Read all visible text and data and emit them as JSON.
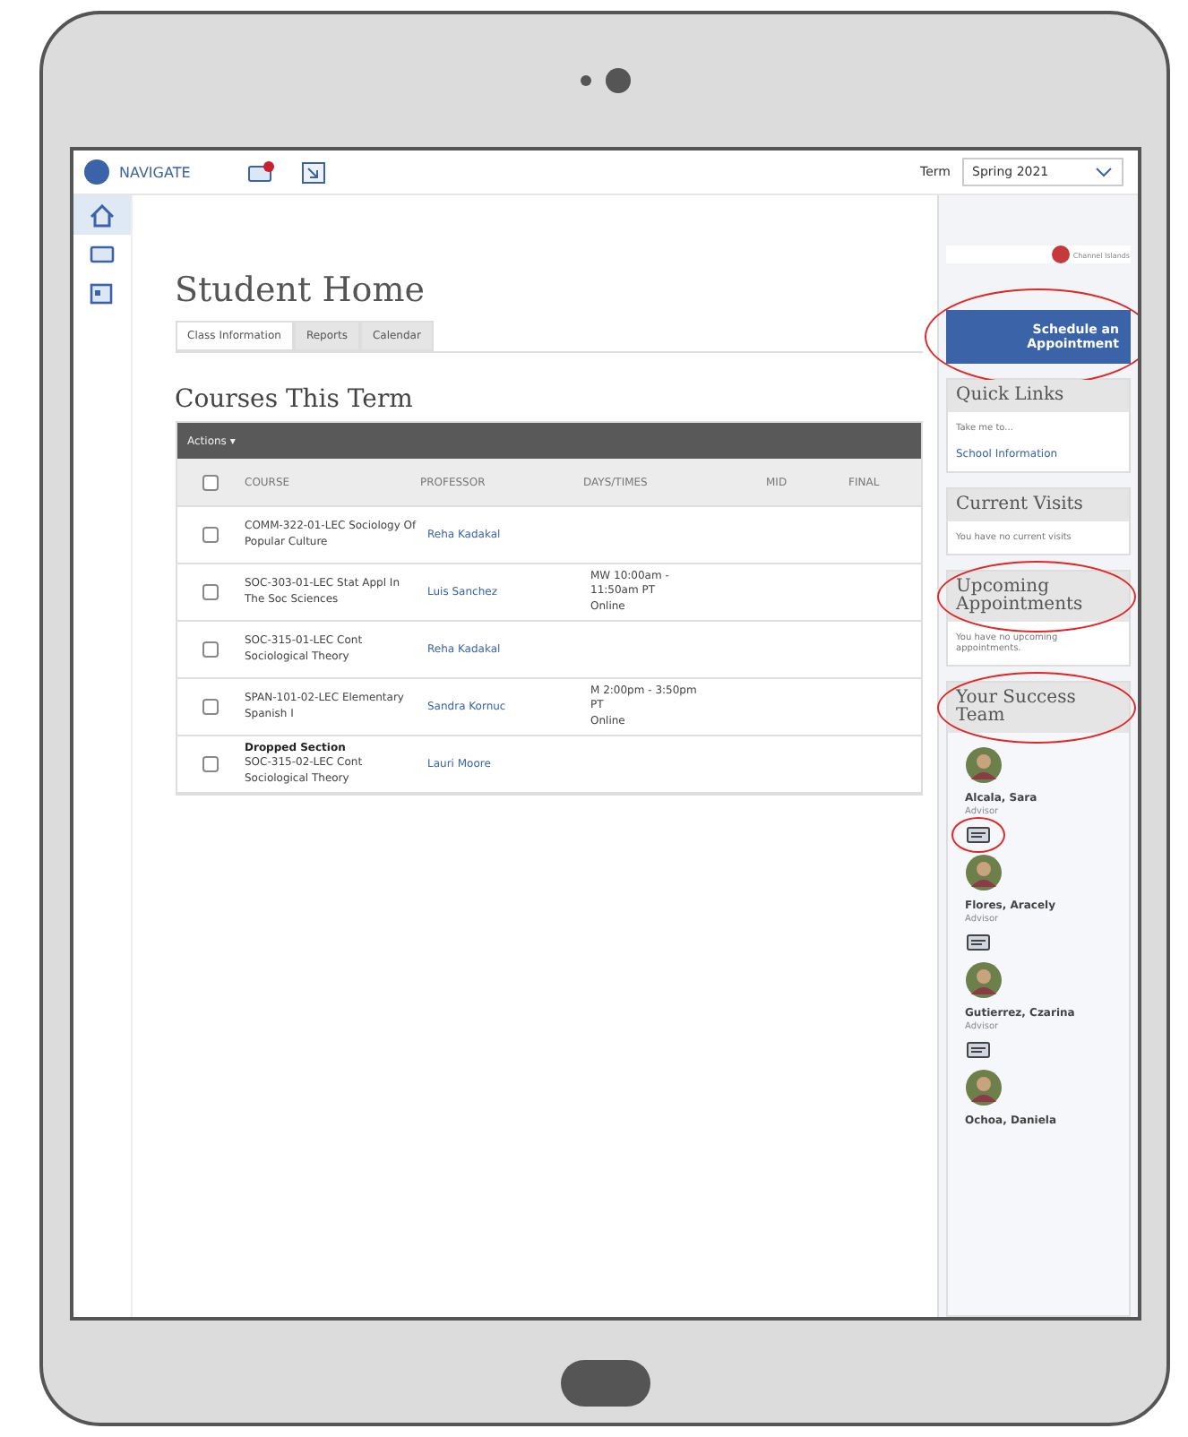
{
  "header": {
    "brand": "NAVIGATE",
    "term_label": "Term",
    "term_value": "Spring 2021",
    "has_notification": true
  },
  "rail": [
    {
      "selected": true
    },
    {
      "selected": false
    },
    {
      "selected": false
    }
  ],
  "page_title": "Student Home",
  "tabs": [
    {
      "label": "Class Information",
      "selected": true
    },
    {
      "label": "Reports",
      "selected": false
    },
    {
      "label": "Calendar",
      "selected": false
    }
  ],
  "section_title": "Courses This Term",
  "table": {
    "actions": "Actions ▾",
    "header_checked": false,
    "columns": [
      "COURSE",
      "PROFESSOR",
      "DAYS/TIMES",
      "MID",
      "FINAL"
    ],
    "rows": [
      {
        "checked": false,
        "note": "",
        "course": "COMM-322-01-LEC Sociology Of Popular Culture",
        "professor": "Reha Kadakal",
        "times": []
      },
      {
        "checked": false,
        "note": "",
        "course": "SOC-303-01-LEC Stat Appl In The Soc Sciences",
        "professor": "Luis Sanchez",
        "times": [
          "MW 10:00am -",
          "11:50am PT",
          "Online"
        ]
      },
      {
        "checked": false,
        "note": "",
        "course": "SOC-315-01-LEC Cont Sociological Theory",
        "professor": "Reha Kadakal",
        "times": []
      },
      {
        "checked": false,
        "note": "",
        "course": "SPAN-101-02-LEC Elementary Spanish I",
        "professor": "Sandra Kornuc",
        "times": [
          "M 2:00pm - 3:50pm",
          "PT",
          "Online"
        ]
      },
      {
        "checked": false,
        "note": "Dropped Section",
        "course": "SOC-315-02-LEC Cont Sociological Theory",
        "professor": "Lauri Moore",
        "times": []
      }
    ]
  },
  "sidebar": {
    "logo_text": "Channel Islands",
    "schedule_button": {
      "label": "Schedule an Appointment",
      "circled": true
    },
    "panels": [
      {
        "title": "Quick Links",
        "circled": false,
        "lines": [
          {
            "text": "Take me to...",
            "kind": "text"
          },
          {
            "text": "School Information",
            "kind": "link"
          }
        ]
      },
      {
        "title": "Current Visits",
        "circled": false,
        "lines": [
          {
            "text": "You have no current visits",
            "kind": "text"
          }
        ]
      },
      {
        "title": "Upcoming Appointments",
        "circled": true,
        "lines": [
          {
            "text": "You have no upcoming appointments.",
            "kind": "text"
          }
        ]
      }
    ],
    "team": {
      "title": "Your Success Team",
      "circled": true,
      "members": [
        {
          "name": "Alcala, Sara",
          "role": "Advisor",
          "message_circled": true
        },
        {
          "name": "Flores, Aracely",
          "role": "Advisor",
          "message_circled": false
        },
        {
          "name": "Gutierrez, Czarina",
          "role": "Advisor",
          "message_circled": false
        },
        {
          "name": "Ochoa, Daniela"
        }
      ]
    }
  }
}
